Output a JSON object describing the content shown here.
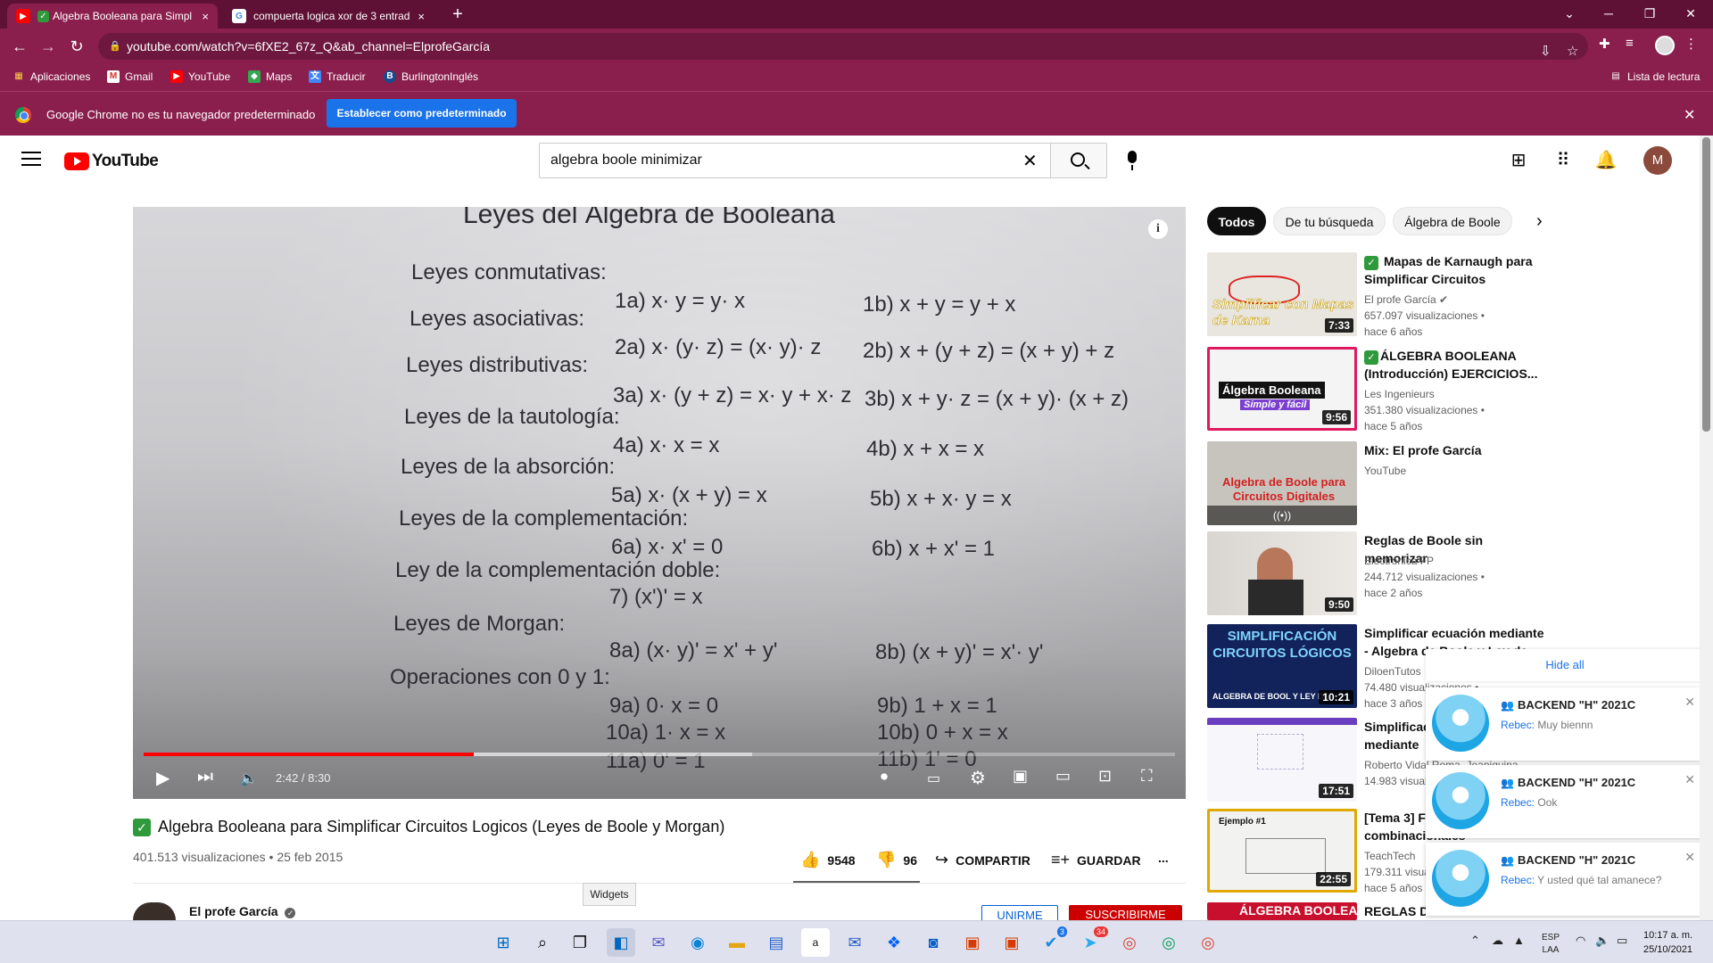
{
  "tabs": [
    {
      "title": "Algebra Booleana para Simpl",
      "close": "×"
    },
    {
      "title": "compuerta logica xor de 3 entrad",
      "close": "×"
    }
  ],
  "new_tab": "+",
  "address": {
    "url": "youtube.com/watch?v=6fXE2_67z_Q&ab_channel=ElprofeGarcía"
  },
  "bookmarks": [
    "Aplicaciones",
    "Gmail",
    "YouTube",
    "Maps",
    "Traducir",
    "BurlingtonInglés"
  ],
  "reading_list": "Lista de lectura",
  "infobar": {
    "message": "Google Chrome no es tu navegador predeterminado",
    "button": "Establecer como predeterminado"
  },
  "youtube": {
    "logo": "YouTube",
    "search_value": "algebra boole minimizar",
    "avatar_letter": "M"
  },
  "video_frame": {
    "header": "Leyes del Álgebra de Booleana",
    "sections": [
      "Leyes conmutativas:",
      "Leyes asociativas:",
      "Leyes distributivas:",
      "Leyes de la tautología:",
      "Leyes de la absorción:",
      "Leyes de la complementación:",
      "Ley de la complementación doble:",
      "Leyes de Morgan:",
      "Operaciones con 0 y 1:"
    ],
    "laws": [
      [
        "1a) x· y = y· x",
        "1b) x + y = y + x"
      ],
      [
        "2a) x· (y· z) = (x· y)· z",
        "2b) x + (y + z) = (x + y) + z"
      ],
      [
        "3a) x· (y + z) = x· y + x· z",
        "3b) x + y· z = (x + y)· (x + z)"
      ],
      [
        "4a) x· x = x",
        "4b) x + x = x"
      ],
      [
        "5a) x· (x + y) = x",
        "5b) x + x· y = x"
      ],
      [
        "6a) x· x' = 0",
        "6b) x + x' = 1"
      ],
      [
        "7) (x')' = x",
        ""
      ],
      [
        "8a) (x· y)' = x' + y'",
        "8b) (x + y)' = x'· y'"
      ],
      [
        "9a) 0· x = 0",
        "9b) 1 + x = 1"
      ],
      [
        "10a) 1· x = x",
        "10b) 0 + x = x"
      ],
      [
        "11a) 0' = 1",
        "11b) 1' = 0"
      ]
    ]
  },
  "player": {
    "time": "2:42 / 8:30",
    "progress": 0.32,
    "buffered": 0.59,
    "info": "i"
  },
  "video": {
    "title": "Algebra Booleana para Simplificar Circuitos Logicos (Leyes de Boole y Morgan)",
    "meta": "401.513 visualizaciones • 25 feb 2015",
    "likes": "9548",
    "dislikes": "96",
    "share": "COMPARTIR",
    "save": "GUARDAR",
    "more": "...",
    "channel": "El profe García",
    "join": "UNIRME",
    "subscribe": "SUSCRIBIRME"
  },
  "tooltip": "Widgets",
  "chips": [
    "Todos",
    "De tu búsqueda",
    "Álgebra de Boole"
  ],
  "recommendations": [
    {
      "title": "Mapas de Karnaugh para Simplificar Circuitos",
      "channel": "El profe García",
      "views": "657.097 visualizaciones •",
      "age": "hace 6 años",
      "duration": "7:33",
      "thumb_text": "Simplificar con Mapas de Karna",
      "verified": true
    },
    {
      "title": "ÁLGEBRA BOOLEANA (Introducción) EJERCICIOS...",
      "channel": "Les Ingenieurs",
      "views": "351.380 visualizaciones •",
      "age": "hace 5 años",
      "duration": "9:56",
      "thumb_text": "Álgebra Booleana",
      "thumb_text2": "Simple y fácil"
    },
    {
      "title": "Mix: El profe García",
      "channel": "YouTube",
      "views": "",
      "age": "",
      "duration": "",
      "thumb_text": "Algebra de Boole para Circuitos Digitales"
    },
    {
      "title": "Reglas de Boole sin memorizar",
      "channel": "Electrónica FP",
      "views": "244.712 visualizaciones •",
      "age": "hace 2 años",
      "duration": "9:50"
    },
    {
      "title": "Simplificar ecuación mediante - Algebra de Boole y Ley de...",
      "channel": "DiloenTutos",
      "views": "74.480 visualizaciones •",
      "age": "hace 3 años",
      "duration": "10:21",
      "thumb_text": "SIMPLIFICACIÓN CIRCUITOS LÓGICOS",
      "thumb_text2": "ALGEBRA DE BOOL Y LEY DE"
    },
    {
      "title": "Simplificación de funciones mediante",
      "channel": "Roberto Vidal Roma, Jeaniquina",
      "views": "14.983 visualizaciones",
      "age": "",
      "duration": "17:51"
    },
    {
      "title": "[Tema 3] Funciones y circuitos combinacionales",
      "channel": "TeachTech",
      "views": "179.311 visualizaciones",
      "age": "hace 5 años",
      "duration": "22:55",
      "thumb_text": "Ejemplo #1"
    },
    {
      "title": "REGLAS DEL ÁLGEBRA DE",
      "channel": "",
      "views": "",
      "age": "",
      "duration": "",
      "thumb_text": "ÁLGEBRA BOOLEANA"
    }
  ],
  "notifications": {
    "hide_all": "Hide all",
    "items": [
      {
        "group": "BACKEND \"H\" 2021C",
        "sender": "Rebec:",
        "text": "Muy biennn"
      },
      {
        "group": "BACKEND \"H\" 2021C",
        "sender": "Rebec:",
        "text": "Ook"
      },
      {
        "group": "BACKEND \"H\" 2021C",
        "sender": "Rebec:",
        "text": "Y usted qué tal amanece?"
      }
    ]
  },
  "taskbar": {
    "lang": "ESP",
    "lang2": "LAA",
    "time": "10:17 a. m.",
    "date": "25/10/2021",
    "badge_whatsapp": "34",
    "badge_check": "3"
  },
  "colors": {
    "chrome_accent": "#8a1f4d",
    "yt_red": "#ff0000",
    "link_blue": "#065fd4",
    "subscribe_red": "#cc0000"
  }
}
